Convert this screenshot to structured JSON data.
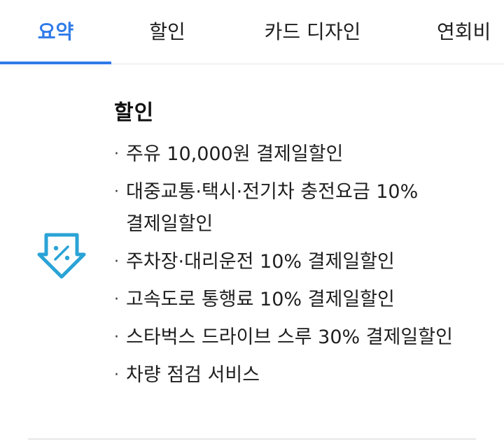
{
  "tabs": [
    {
      "label": "요약",
      "active": true
    },
    {
      "label": "할인",
      "active": false
    },
    {
      "label": "카드 디자인",
      "active": false
    },
    {
      "label": "연회비",
      "active": false
    }
  ],
  "section": {
    "title": "할인",
    "icon": "discount-tag-icon",
    "items": [
      "주유 10,000원 결제일할인",
      "대중교통·택시·전기차 충전요금 10% 결제일할인",
      "주차장·대리운전 10% 결제일할인",
      "고속도로 통행료 10% 결제일할인",
      "스타벅스 드라이브 스루 30% 결제일할인",
      "차량 점검 서비스"
    ]
  },
  "colors": {
    "accent": "#2f7be8",
    "icon": "#2aa3d6",
    "divider": "#e6e6e6"
  }
}
